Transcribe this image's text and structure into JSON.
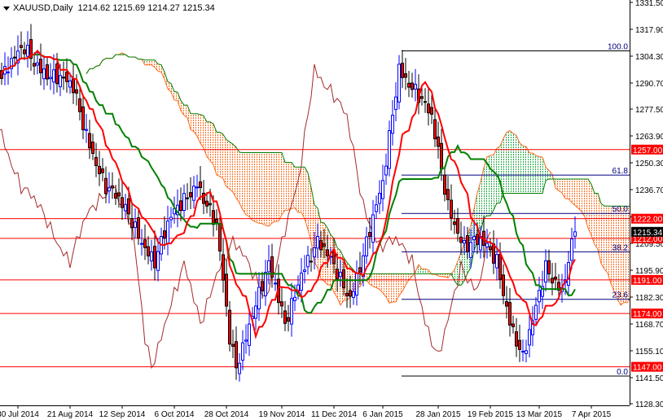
{
  "chart_data": {
    "type": "candlestick",
    "symbol": "XAUUSD",
    "timeframe": "Daily",
    "ohlc_current": {
      "open": "1214.62",
      "high": "1215.69",
      "low": "1214.27",
      "close": "1215.34"
    },
    "current_price_label": "1215.34",
    "ylim": [
      1128.3,
      1331.5
    ],
    "y_tick_labels": [
      "1331.50",
      "1317.90",
      "1304.30",
      "1290.70",
      "1277.50",
      "1263.90",
      "1250.30",
      "1236.70",
      "1222.90",
      "1209.50",
      "1195.90",
      "1182.30",
      "1168.70",
      "1155.10",
      "1141.50",
      "1128.30"
    ],
    "x_tick_labels": [
      {
        "index": 5,
        "label": "30 Jul 2014"
      },
      {
        "index": 21,
        "label": "21 Aug 2014"
      },
      {
        "index": 37,
        "label": "12 Sep 2014"
      },
      {
        "index": 53,
        "label": "6 Oct 2014"
      },
      {
        "index": 69,
        "label": "28 Oct 2014"
      },
      {
        "index": 86,
        "label": "19 Nov 2014"
      },
      {
        "index": 102,
        "label": "11 Dec 2014"
      },
      {
        "index": 117,
        "label": "6 Jan 2015"
      },
      {
        "index": 134,
        "label": "28 Jan 2015"
      },
      {
        "index": 150,
        "label": "19 Feb 2015"
      },
      {
        "index": 165,
        "label": "13 Mar 2015"
      },
      {
        "index": 181,
        "label": "7 Apr 2015"
      }
    ],
    "close_keypoints": [
      [
        0,
        1293
      ],
      [
        7,
        1308
      ],
      [
        15,
        1295
      ],
      [
        22,
        1287
      ],
      [
        25,
        1271
      ],
      [
        32,
        1238
      ],
      [
        40,
        1221
      ],
      [
        47,
        1201
      ],
      [
        52,
        1221
      ],
      [
        60,
        1242
      ],
      [
        66,
        1217
      ],
      [
        70,
        1160
      ],
      [
        72,
        1147
      ],
      [
        77,
        1176
      ],
      [
        82,
        1197
      ],
      [
        87,
        1168
      ],
      [
        92,
        1197
      ],
      [
        97,
        1209
      ],
      [
        102,
        1197
      ],
      [
        107,
        1184
      ],
      [
        112,
        1209
      ],
      [
        117,
        1238
      ],
      [
        122,
        1300
      ],
      [
        127,
        1287
      ],
      [
        132,
        1271
      ],
      [
        137,
        1230
      ],
      [
        142,
        1209
      ],
      [
        147,
        1209
      ],
      [
        152,
        1201
      ],
      [
        156,
        1172
      ],
      [
        160,
        1151
      ],
      [
        163,
        1168
      ],
      [
        167,
        1197
      ],
      [
        172,
        1188
      ],
      [
        176,
        1215.34
      ]
    ],
    "horizontal_levels": [
      {
        "price": 1257.0,
        "label": "1257.00"
      },
      {
        "price": 1222.0,
        "label": "1222.00"
      },
      {
        "price": 1212.0,
        "label": "1212.00"
      },
      {
        "price": 1191.0,
        "label": "1191.00"
      },
      {
        "price": 1174.0,
        "label": "1174.00"
      },
      {
        "price": 1147.0,
        "label": "1147.00"
      }
    ],
    "fibonacci": {
      "low": 1142.3,
      "high": 1307.0,
      "start_index": 124,
      "levels": [
        {
          "ratio": 1.0,
          "label": "100.0"
        },
        {
          "ratio": 0.618,
          "label": "61.8"
        },
        {
          "ratio": 0.5,
          "label": "50.0"
        },
        {
          "ratio": 0.382,
          "label": "38.2"
        },
        {
          "ratio": 0.236,
          "label": "23.6"
        },
        {
          "ratio": 0.0,
          "label": "0.0"
        }
      ]
    },
    "indicators": [
      "Ichimoku Kinko Hyo (9,26,52)"
    ],
    "colors": {
      "bull": "#0000ff",
      "bear_body": "#ff0000",
      "level": "#ff0000",
      "fib": "#000080",
      "tenkan": "#ff0000",
      "kijun": "#008000",
      "chikou": "#a52a2a",
      "kumo_bear": "#ff6a1a",
      "kumo_bull": "#22aa44"
    }
  }
}
